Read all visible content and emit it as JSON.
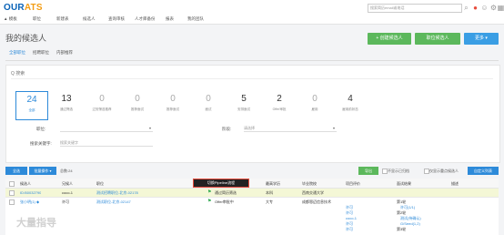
{
  "app": {
    "logo_a": "OUR",
    "logo_b": "ATS",
    "search_placeholder": "搜索简历email或电话"
  },
  "nav": [
    {
      "label": "▲ 模板"
    },
    {
      "label": "职位"
    },
    {
      "label": "新建表"
    },
    {
      "label": "候选人"
    },
    {
      "label": "查询审核"
    },
    {
      "label": "人才库备份"
    },
    {
      "label": "报表"
    },
    {
      "label": "我的团队"
    }
  ],
  "page": {
    "title": "我的候选人"
  },
  "buttons": {
    "create": "+ 创建候选人",
    "bulk": "职位候选人",
    "more": "更多 ▾"
  },
  "tabs": [
    "全部职位",
    "招聘职位",
    "内部推荐"
  ],
  "search": {
    "label": "Q 搜索"
  },
  "stats": [
    {
      "num": "24",
      "label": "全部"
    },
    {
      "num": "13",
      "label": "通过筛选"
    },
    {
      "num": "0",
      "label": "过安筛选推荐"
    },
    {
      "num": "0",
      "label": "推荐面试"
    },
    {
      "num": "0",
      "label": "推荐面试"
    },
    {
      "num": "0",
      "label": "面试"
    },
    {
      "num": "5",
      "label": "安排面试"
    },
    {
      "num": "2",
      "label": "Offer审批"
    },
    {
      "num": "0",
      "label": "雇用"
    },
    {
      "num": "4",
      "label": "雇用前状态"
    }
  ],
  "filters": {
    "job_label": "职位:",
    "stage_label": "阶段:",
    "stage_value": "请选择",
    "keyword_label": "搜索关键字:",
    "keyword_placeholder": "搜索关键字"
  },
  "toolbar": {
    "select_all": "全选",
    "bulk_ops": "批量操作 ▾",
    "count": "总数:24",
    "export": "导出",
    "opt1": "不显示已归档",
    "opt2": "仅显示重点候选人",
    "opt3": "自定义列表"
  },
  "columns": [
    "候选人",
    "兄候人",
    "职位",
    "状态",
    "最高学历",
    "毕业院校",
    "项目评价",
    "面试结果",
    "描述"
  ],
  "rows": [
    {
      "name": "ID:B0032790",
      "owner": "coco-1",
      "job": "测试招聘职位-北京-02178",
      "status": "通过简历筛选",
      "edu": "本科",
      "school": "西南交通大学"
    },
    {
      "name": "张小明(1) ◆",
      "owner": "许可",
      "job": "测试职位-北京-02147",
      "status": "Offer审批中",
      "edu": "大专",
      "school": "成都恩迈信息技术"
    }
  ],
  "row2_eval": [
    "许可",
    "许可",
    "coco-1",
    "许可",
    "许可"
  ],
  "row2_result": [
    "第1轮",
    "许可(1/1)",
    "第2轮",
    "测试(待确认)",
    "G/Seed(1,2)",
    "第3轮"
  ],
  "tooltip": "切换Pipeline流程",
  "watermark": "大量指导"
}
